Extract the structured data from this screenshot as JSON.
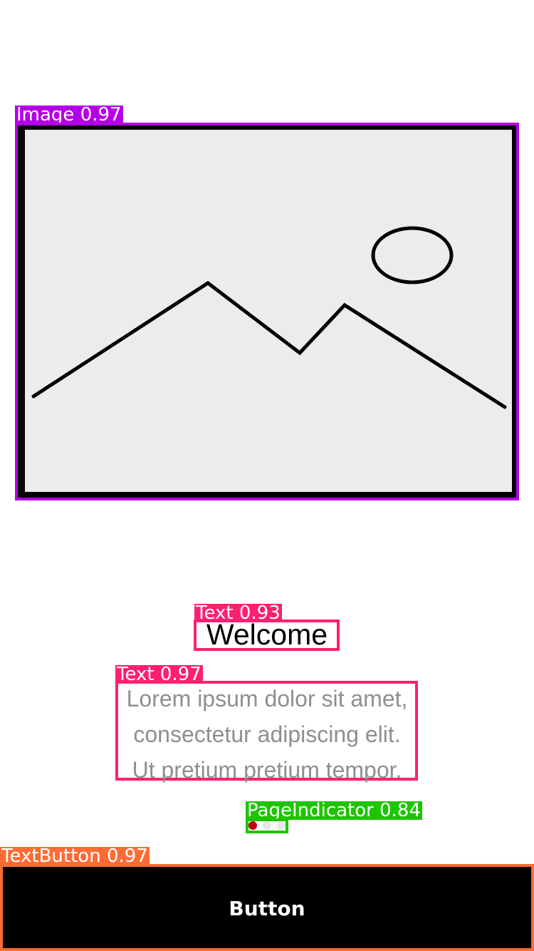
{
  "detections": {
    "image_label": "Image 0.97",
    "welcome_label": "Text 0.93",
    "body_label": "Text 0.97",
    "indicator_label": "PageIndicator 0.84",
    "button_label": "TextButton 0.97"
  },
  "content": {
    "title": "Welcome",
    "body_lines": [
      "Lorem ipsum dolor sit amet,",
      "consectetur adipiscing elit.",
      "Ut pretium pretium tempor."
    ],
    "button_text": "Button"
  },
  "page_indicator": {
    "active_index": 0,
    "dots": 3
  },
  "colors": {
    "image_box": "#b400e6",
    "text_box": "#ff1f6f",
    "indicator_box": "#1ec400",
    "button_box": "#ff6b35",
    "active_dot": "#c40014",
    "body_text": "#8e8e93"
  },
  "icons": {
    "image_placeholder": "landscape-placeholder-icon"
  }
}
